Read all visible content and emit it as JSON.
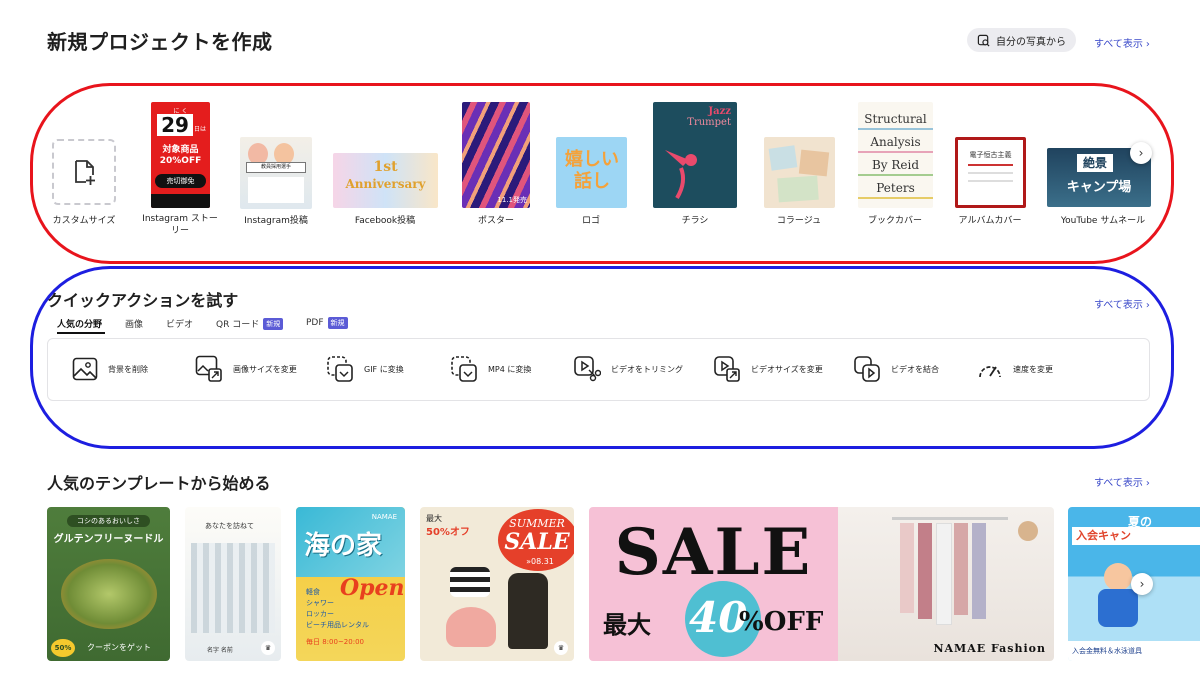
{
  "new_project": {
    "title": "新規プロジェクトを作成",
    "from_photos": "自分の写真から",
    "see_all": "すべて表示",
    "items": [
      {
        "label": "カスタムサイズ"
      },
      {
        "label": "Instagram ストーリー"
      },
      {
        "label": "Instagram投稿"
      },
      {
        "label": "Facebook投稿"
      },
      {
        "label": "ポスター"
      },
      {
        "label": "ロゴ"
      },
      {
        "label": "チラシ"
      },
      {
        "label": "コラージュ"
      },
      {
        "label": "ブックカバー"
      },
      {
        "label": "アルバムカバー"
      },
      {
        "label": "YouTube サムネール"
      }
    ],
    "thumb_text": {
      "story_num": "29",
      "story_sub": "日は",
      "story_line1": "対象商品",
      "story_line2": "20%OFF",
      "story_badge": "売切御免",
      "story_top": "に く",
      "post_banner": "教員採用選手",
      "anniv_1": "1st",
      "anniv_2": "Anniversary",
      "poster_num": "11.1発売",
      "logo_text": "嬉しい話し",
      "flyer_title": "Jazz",
      "flyer_title2": "Trumpet",
      "book_1": "Structural",
      "book_2": "Analysis",
      "book_3": "By Reid",
      "book_4": "Peters",
      "album_title": "電子恒古主義",
      "yt_1": "絶景",
      "yt_2": "キャンプ場"
    }
  },
  "quick_actions": {
    "title": "クイックアクションを試す",
    "see_all": "すべて表示",
    "tabs": [
      {
        "label": "人気の分野",
        "badge": ""
      },
      {
        "label": "画像",
        "badge": ""
      },
      {
        "label": "ビデオ",
        "badge": ""
      },
      {
        "label": "QR コード",
        "badge": "新規"
      },
      {
        "label": "PDF",
        "badge": "新規"
      }
    ],
    "actions": [
      {
        "label": "背景を削除",
        "icon": "image-icon"
      },
      {
        "label": "画像サイズを変更",
        "icon": "image-resize-icon"
      },
      {
        "label": "GIF に変換",
        "icon": "gif-convert-icon"
      },
      {
        "label": "MP4 に変換",
        "icon": "mp4-convert-icon"
      },
      {
        "label": "ビデオをトリミング",
        "icon": "video-trim-icon"
      },
      {
        "label": "ビデオサイズを変更",
        "icon": "video-resize-icon"
      },
      {
        "label": "ビデオを結合",
        "icon": "video-merge-icon"
      },
      {
        "label": "速度を変更",
        "icon": "speed-icon"
      }
    ]
  },
  "templates": {
    "title": "人気のテンプレートから始める",
    "see_all": "すべて表示",
    "cards": {
      "t1_top": "コシのあるおいしさ",
      "t1_title": "グルテンフリーヌードル",
      "t1_badge": "クーポンをゲット",
      "t1_pct": "50%",
      "t2_top": "あなたを訪ねて",
      "t2_name": "名字 名前",
      "t3_brand": "NAMAE",
      "t3_title": "海の家",
      "t3_open": "Open",
      "t3_items": "軽食\nシャワー\nロッカー\nビーチ用品レンタル",
      "t3_hours": "毎日 8:00~20:00",
      "t4_top": "最大",
      "t4_pct": "50%オフ",
      "t4_summer": "SUMMER",
      "t4_sale": "SALE",
      "t4_date": "»08.31",
      "t5_sale": "SALE",
      "t5_prefix": "最大",
      "t5_pct": "40",
      "t5_off": "%OFF",
      "t6_brand": "NAMAE Fashion",
      "t7_title": "夏の",
      "t7_sub": "入会キャン",
      "t7_foot": "入会金無料＆水泳道具"
    }
  },
  "colors": {
    "accent": "#3a49c9",
    "badge": "#5b5bd6",
    "ring_red": "#e8141c",
    "ring_blue": "#1d1ee0"
  }
}
